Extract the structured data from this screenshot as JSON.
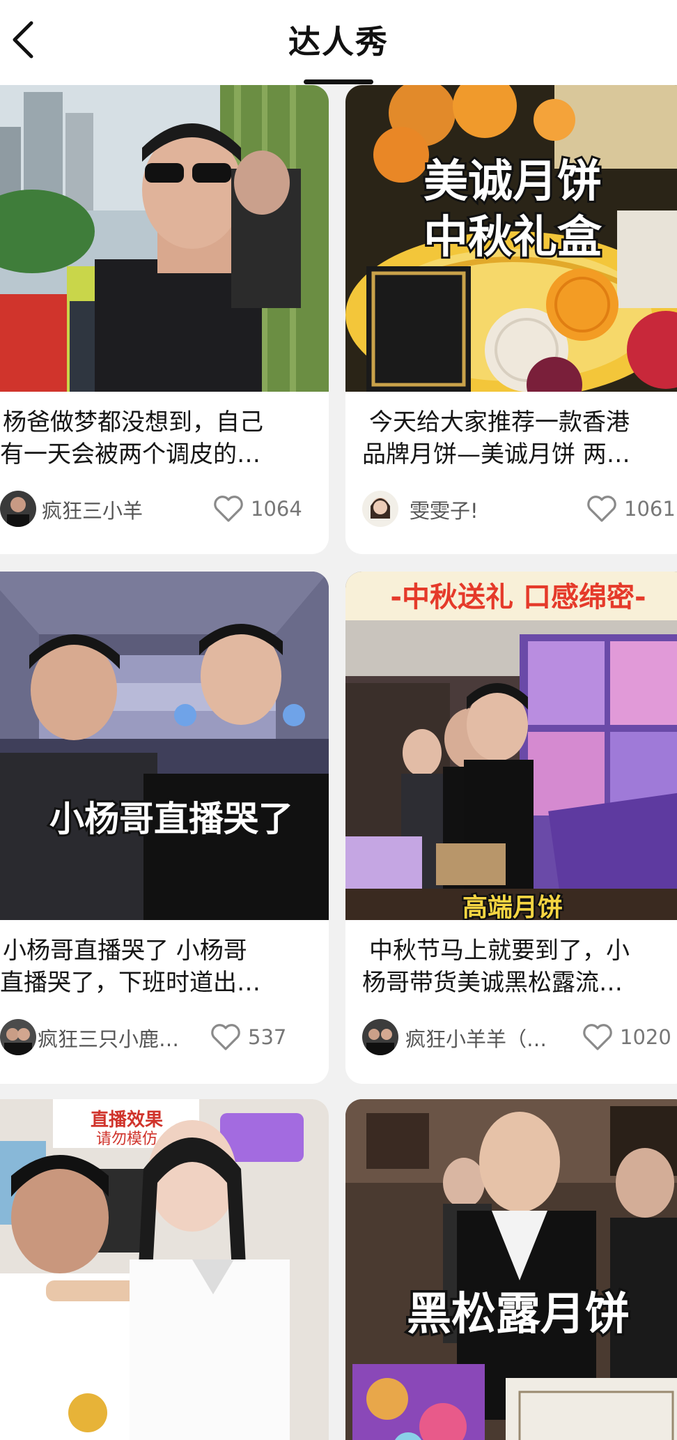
{
  "header": {
    "title": "达人秀"
  },
  "cards": [
    {
      "description": "杨爸做梦都没想到，自己有一天会被两个调皮的…",
      "line1": "杨爸做梦都没想到，自己",
      "line2": "有一天会被两个调皮的…",
      "author": "疯狂三小羊",
      "likes": "1064"
    },
    {
      "description": "今天给大家推荐一款香港品牌月饼—美诚月饼 两…",
      "line1": "今天给大家推荐一款香港",
      "line2": "品牌月饼—美诚月饼 两…",
      "author": "雯雯子!",
      "likes": "1061",
      "overlay_line1": "美诚月饼",
      "overlay_line2": "中秋礼盒"
    },
    {
      "description": "小杨哥直播哭了 小杨哥直播哭了，下班时道出…",
      "line1": "小杨哥直播哭了 小杨哥",
      "line2": "直播哭了，下班时道出…",
      "author": "疯狂三只小鹿【…",
      "likes": "537",
      "overlay_text": "小杨哥直播哭了"
    },
    {
      "description": "中秋节马上就要到了，小杨哥带货美诚黑松露流…",
      "line1": "中秋节马上就要到了，小",
      "line2": "杨哥带货美诚黑松露流…",
      "author": "疯狂小羊羊（…",
      "likes": "1020",
      "overlay_banner": "-中秋送礼 口感绵密-",
      "overlay_bottom": "高端月饼"
    },
    {
      "sign_text": "直播效果",
      "sign_text2": "请勿模仿"
    },
    {
      "overlay_text": "黑松露月饼"
    }
  ],
  "icons": {
    "back": "chevron-left-icon",
    "like": "heart-outline-icon"
  },
  "colors": {
    "background": "#f1f1f1",
    "card": "#ffffff",
    "text": "#161616",
    "muted": "#777777"
  }
}
